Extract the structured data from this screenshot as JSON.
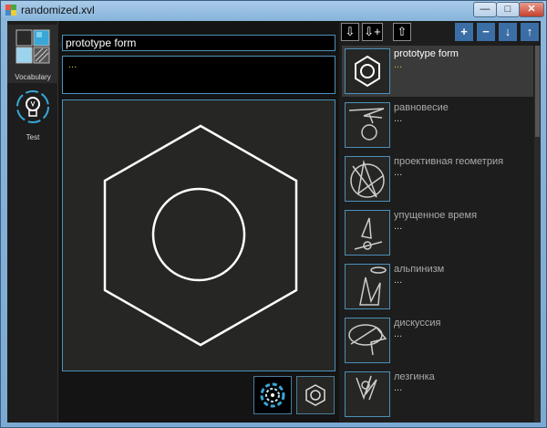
{
  "window": {
    "title": "randomized.xvl",
    "min_label": "—",
    "max_label": "□",
    "close_label": "✕"
  },
  "nav": {
    "items": [
      {
        "label": "Vocabulary",
        "icon": "grid-icon",
        "active": true
      },
      {
        "label": "Test",
        "icon": "lightbulb-icon",
        "active": false
      }
    ]
  },
  "editor": {
    "name": "prototype form",
    "description": "..."
  },
  "toolbar": {
    "import_label": "⇩",
    "import_add_label": "⇩+",
    "export_label": "⇧",
    "add_label": "+",
    "remove_label": "−",
    "move_down_label": "↓",
    "move_up_label": "↑"
  },
  "list": {
    "items": [
      {
        "title": "prototype form",
        "sub": "...",
        "selected": true
      },
      {
        "title": "равновесие",
        "sub": "...",
        "selected": false
      },
      {
        "title": "проективная геометрия",
        "sub": "...",
        "selected": false
      },
      {
        "title": "упущенное время",
        "sub": "...",
        "selected": false
      },
      {
        "title": "альпинизм",
        "sub": "...",
        "selected": false
      },
      {
        "title": "дискуссия",
        "sub": "...",
        "selected": false
      },
      {
        "title": "лезгинка",
        "sub": "...",
        "selected": false
      }
    ]
  },
  "colors": {
    "accent": "#4c90b8",
    "highlight_text": "#d4b63a"
  }
}
